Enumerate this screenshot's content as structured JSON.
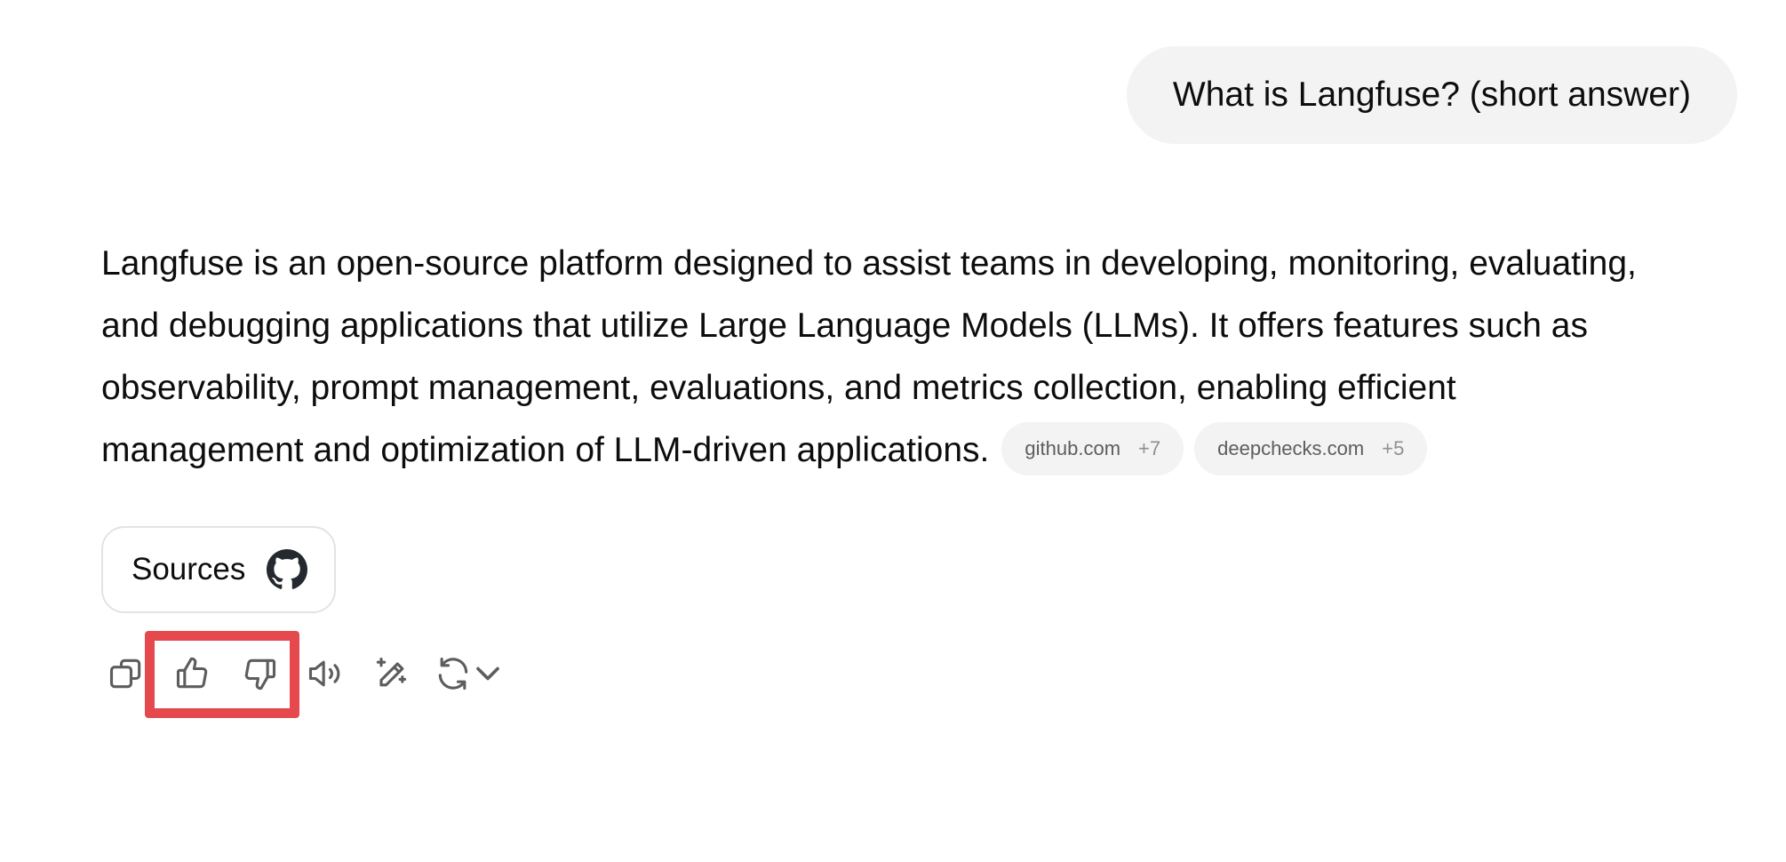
{
  "conversation": {
    "user_message": "What is Langfuse? (short answer)",
    "assistant_lines": [
      "Langfuse is an open-source platform designed to assist teams in developing, monitoring, evaluating,",
      "and debugging applications that utilize Large Language Models (LLMs). It offers features such as",
      "observability, prompt management, evaluations, and metrics collection, enabling efficient",
      "management and optimization of LLM-driven applications."
    ],
    "citations": [
      {
        "domain": "github.com",
        "count": "+7"
      },
      {
        "domain": "deepchecks.com",
        "count": "+5"
      }
    ],
    "sources_label": "Sources"
  },
  "actions": {
    "icons": [
      "copy-icon",
      "thumbs-up-icon",
      "thumbs-down-icon",
      "read-aloud-icon",
      "edit-icon",
      "regenerate-icon",
      "chevron-down-icon"
    ],
    "highlight_color": "#e5484d"
  }
}
